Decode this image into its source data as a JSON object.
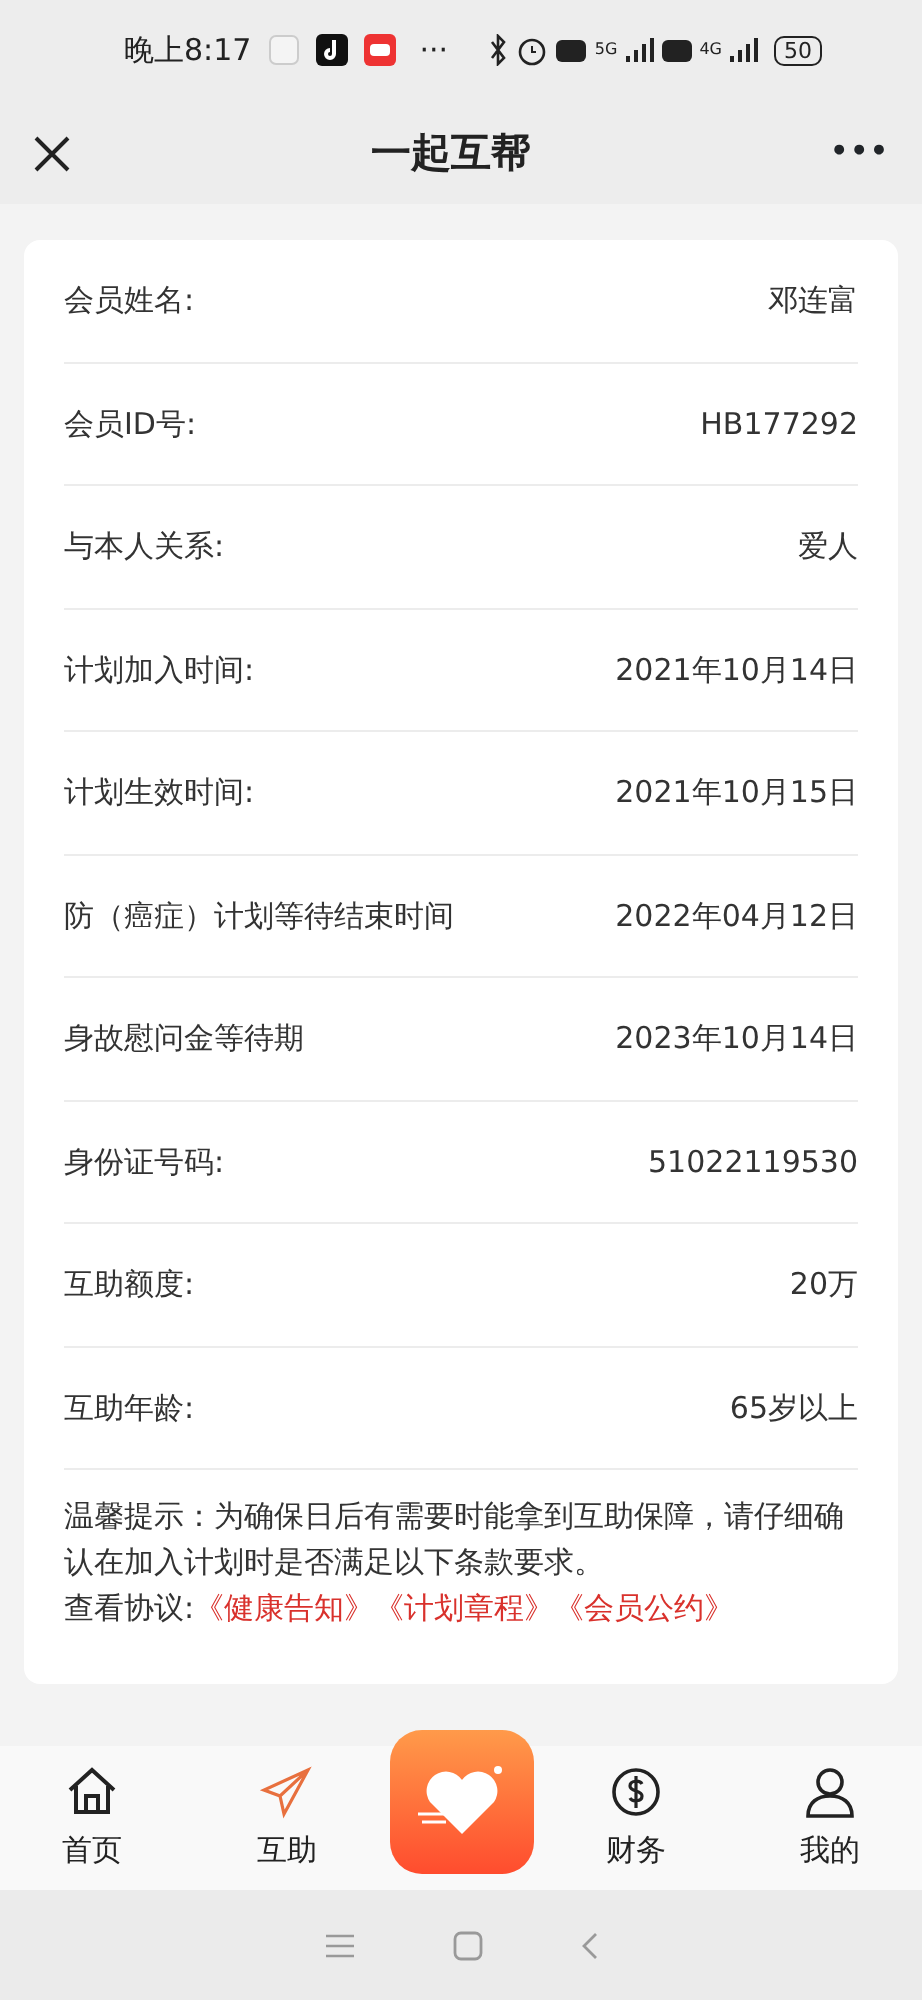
{
  "status_bar": {
    "time": "晚上8:17",
    "more": "···",
    "network_1": "5G",
    "network_2": "4G",
    "battery": "50"
  },
  "header": {
    "title": "一起互帮",
    "more": "•••"
  },
  "fields": [
    {
      "label": "会员姓名:",
      "value": "邓连富"
    },
    {
      "label": "会员ID号:",
      "value": "HB177292"
    },
    {
      "label": "与本人关系:",
      "value": "爱人"
    },
    {
      "label": "计划加入时间:",
      "value": "2021年10月14日"
    },
    {
      "label": "计划生效时间:",
      "value": "2021年10月15日"
    },
    {
      "label": "防（癌症）计划等待结束时间",
      "value": "2022年04月12日"
    },
    {
      "label": "身故慰问金等待期",
      "value": "2023年10月14日"
    },
    {
      "label": "身份证号码:",
      "value": "51022119530"
    },
    {
      "label": "互助额度:",
      "value": "20万"
    },
    {
      "label": "互助年龄:",
      "value": "65岁以上"
    }
  ],
  "notice": {
    "text": "温馨提示：为确保日后有需要时能拿到互助保障，请仔细确认在加入计划时是否满足以下条款要求。",
    "agreements_label": "查看协议:",
    "links": [
      "《健康告知》",
      "《计划章程》",
      "《会员公约》"
    ]
  },
  "tabs": [
    {
      "kind": "home",
      "label": "首页",
      "selected": false
    },
    {
      "kind": "send",
      "label": "互助",
      "selected": true
    },
    {
      "kind": "center"
    },
    {
      "kind": "finance",
      "label": "财务",
      "selected": false
    },
    {
      "kind": "profile",
      "label": "我的",
      "selected": false
    }
  ]
}
